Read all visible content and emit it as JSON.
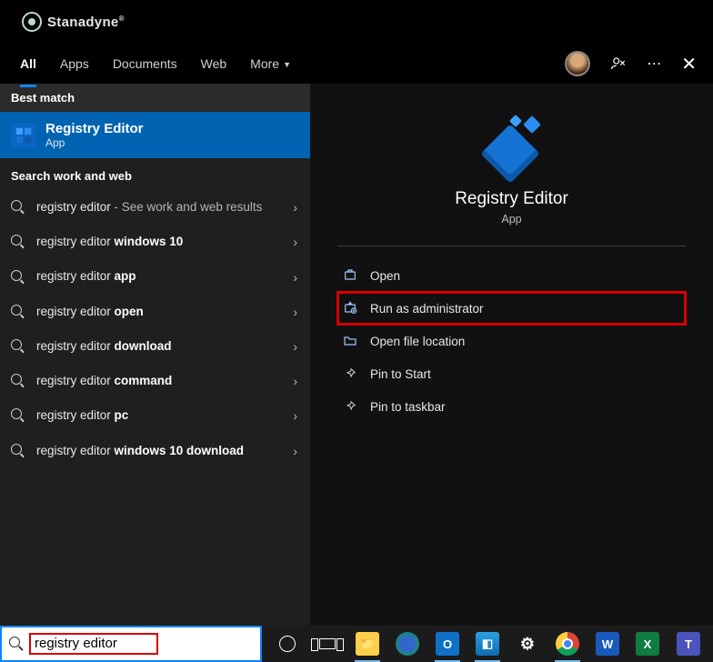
{
  "brand": {
    "name": "Stanadyne"
  },
  "tabs": {
    "items": [
      {
        "label": "All",
        "active": true
      },
      {
        "label": "Apps",
        "active": false
      },
      {
        "label": "Documents",
        "active": false
      },
      {
        "label": "Web",
        "active": false
      },
      {
        "label": "More",
        "active": false,
        "dropdown": true
      }
    ]
  },
  "sections": {
    "best_match_label": "Best match",
    "best_match_title": "Registry Editor",
    "best_match_sub": "App",
    "work_web_label": "Search work and web"
  },
  "suggestions": [
    {
      "prefix": "registry editor",
      "muted": " - See work and web results",
      "bold": ""
    },
    {
      "prefix": "registry editor ",
      "bold": "windows 10"
    },
    {
      "prefix": "registry editor ",
      "bold": "app"
    },
    {
      "prefix": "registry editor ",
      "bold": "open"
    },
    {
      "prefix": "registry editor ",
      "bold": "download"
    },
    {
      "prefix": "registry editor ",
      "bold": "command"
    },
    {
      "prefix": "registry editor ",
      "bold": "pc"
    },
    {
      "prefix": "registry editor ",
      "bold": "windows 10 download"
    }
  ],
  "preview": {
    "title": "Registry Editor",
    "sub": "App",
    "actions": [
      {
        "icon": "open",
        "label": "Open",
        "hl": false
      },
      {
        "icon": "admin",
        "label": "Run as administrator",
        "hl": true
      },
      {
        "icon": "folder",
        "label": "Open file location",
        "hl": false
      },
      {
        "icon": "pin-start",
        "label": "Pin to Start",
        "hl": false
      },
      {
        "icon": "pin-task",
        "label": "Pin to taskbar",
        "hl": false
      }
    ]
  },
  "search": {
    "value": "registry editor"
  },
  "taskbar": {
    "apps": [
      {
        "name": "cortana"
      },
      {
        "name": "taskview"
      },
      {
        "name": "explorer",
        "active": true
      },
      {
        "name": "edge"
      },
      {
        "name": "outlook",
        "active": true
      },
      {
        "name": "viewer",
        "active": true
      },
      {
        "name": "settings"
      },
      {
        "name": "chrome",
        "active": true
      },
      {
        "name": "word"
      },
      {
        "name": "excel"
      },
      {
        "name": "teams"
      }
    ]
  }
}
